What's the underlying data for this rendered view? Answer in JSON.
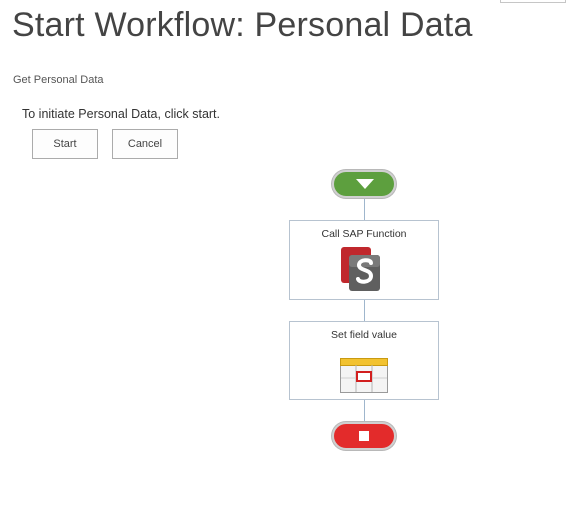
{
  "page": {
    "title": "Start Workflow: Personal Data",
    "subtitle": "Get Personal Data",
    "instruction": "To initiate Personal Data, click start."
  },
  "buttons": {
    "start_label": "Start",
    "cancel_label": "Cancel"
  },
  "workflow": {
    "start_node": {
      "icon": "play-down-arrow-icon",
      "color": "#5d9f3e"
    },
    "actions": [
      {
        "label": "Call SAP Function",
        "icon": "sap-function-icon"
      },
      {
        "label": "Set field value",
        "icon": "set-field-value-icon"
      }
    ],
    "end_node": {
      "icon": "stop-square-icon",
      "color": "#e32b2b"
    }
  },
  "colors": {
    "connector": "#9fb6cd",
    "box_border": "#b7c3d0"
  }
}
